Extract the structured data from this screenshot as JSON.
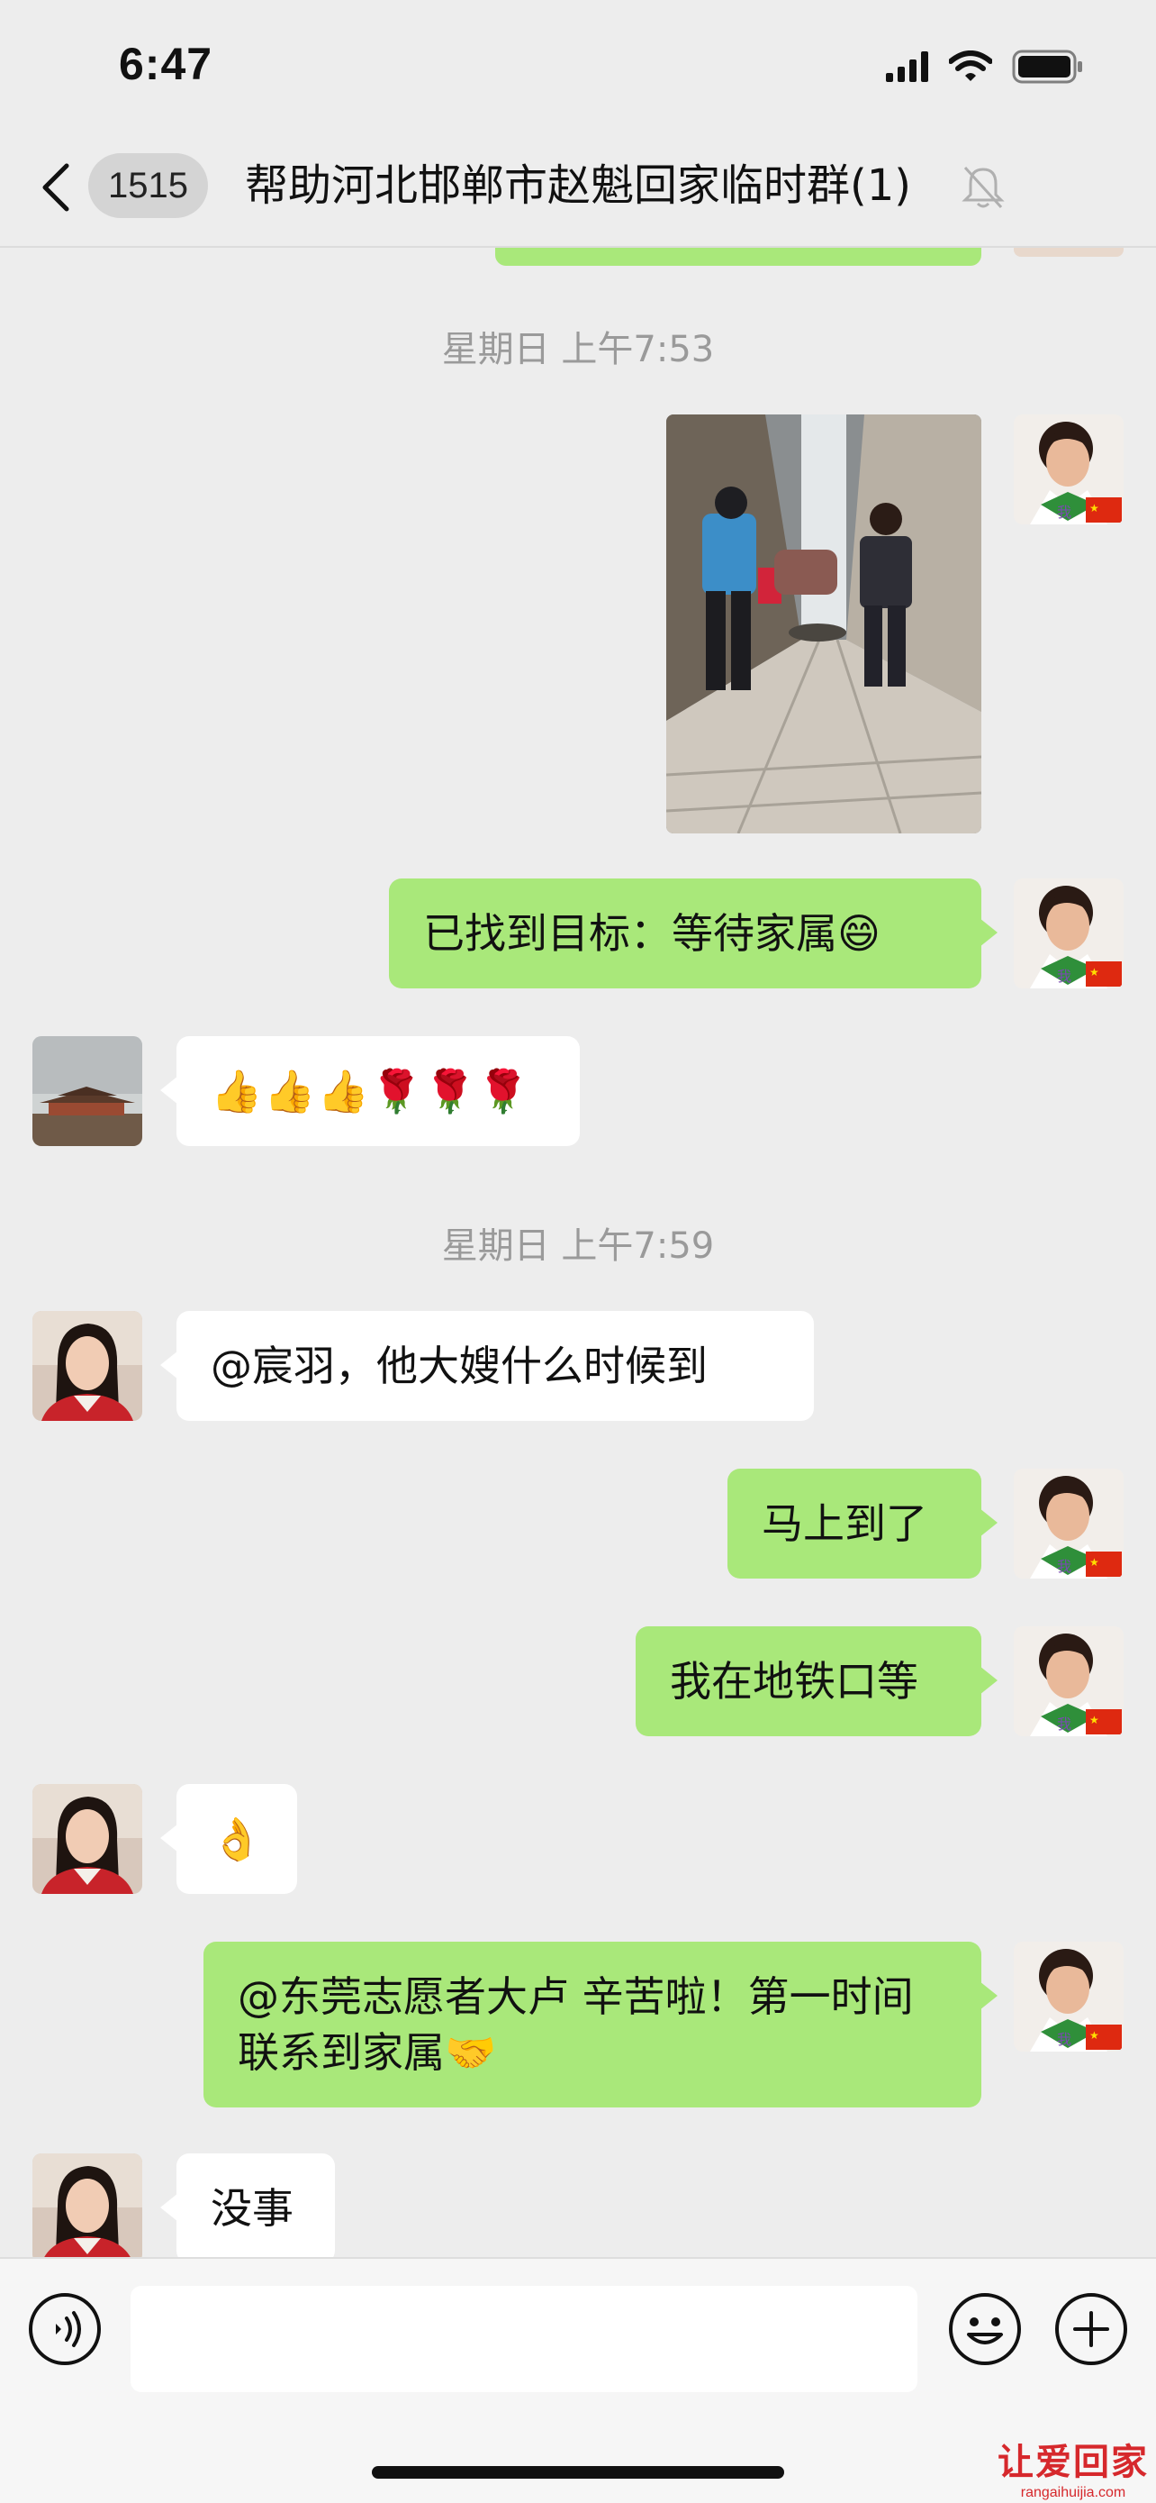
{
  "status_bar": {
    "time": "6:47"
  },
  "nav": {
    "unread_count": "1515",
    "title": "帮助河北邯郸市赵魁回家临时群(1)"
  },
  "messages": {
    "ts1": "星期日 上午7:53",
    "m_found": "已找到目标：等待家属😄",
    "m_thumbs": "👍👍👍🌹🌹🌹",
    "ts2": "星期日 上午7:59",
    "m_when": "@宸羽，他大嫂什么时候到",
    "m_soon": "马上到了",
    "m_subway": "我在地铁口等",
    "m_ok": "👌",
    "m_thanks": "@东莞志愿者大卢 辛苦啦！第一时间联系到家属🤝",
    "m_noproblem": "没事"
  },
  "input": {
    "value": ""
  },
  "watermark": {
    "title": "让爱回家",
    "url": "rangaihuijia.com"
  },
  "colors": {
    "my_bubble": "#a9e87a",
    "other_bubble": "#ffffff",
    "background": "#ededed"
  },
  "icons": [
    "back-icon",
    "bell-mute-icon",
    "voice-icon",
    "emoji-icon",
    "plus-icon",
    "signal-icon",
    "wifi-icon",
    "battery-icon"
  ]
}
